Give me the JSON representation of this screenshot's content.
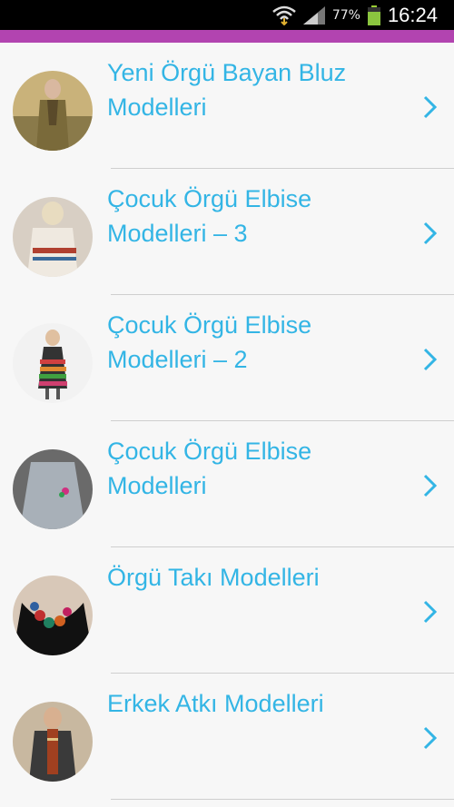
{
  "status_bar": {
    "battery_percent": "77%",
    "time": "16:24"
  },
  "colors": {
    "accent": "#b244b0",
    "title_text": "#33b5e5",
    "chevron": "#33b5e5"
  },
  "items": [
    {
      "title_line1": "Yeni Örgü Bayan Bluz",
      "title_line2": "Modelleri",
      "image": "woman-knit-sweater-photo"
    },
    {
      "title_line1": "Çocuk Örgü Elbise",
      "title_line2": "Modelleri – 3",
      "image": "child-knit-dress-photo"
    },
    {
      "title_line1": "Çocuk Örgü Elbise",
      "title_line2": "Modelleri – 2",
      "image": "striped-dress-photo"
    },
    {
      "title_line1": "Çocuk Örgü Elbise",
      "title_line2": "Modelleri",
      "image": "gray-knit-coat-photo"
    },
    {
      "title_line1": "Örgü Takı Modelleri",
      "title_line2": "",
      "image": "knit-necklace-photo"
    },
    {
      "title_line1": "Erkek Atkı Modelleri",
      "title_line2": "",
      "image": "man-scarf-photo"
    }
  ]
}
